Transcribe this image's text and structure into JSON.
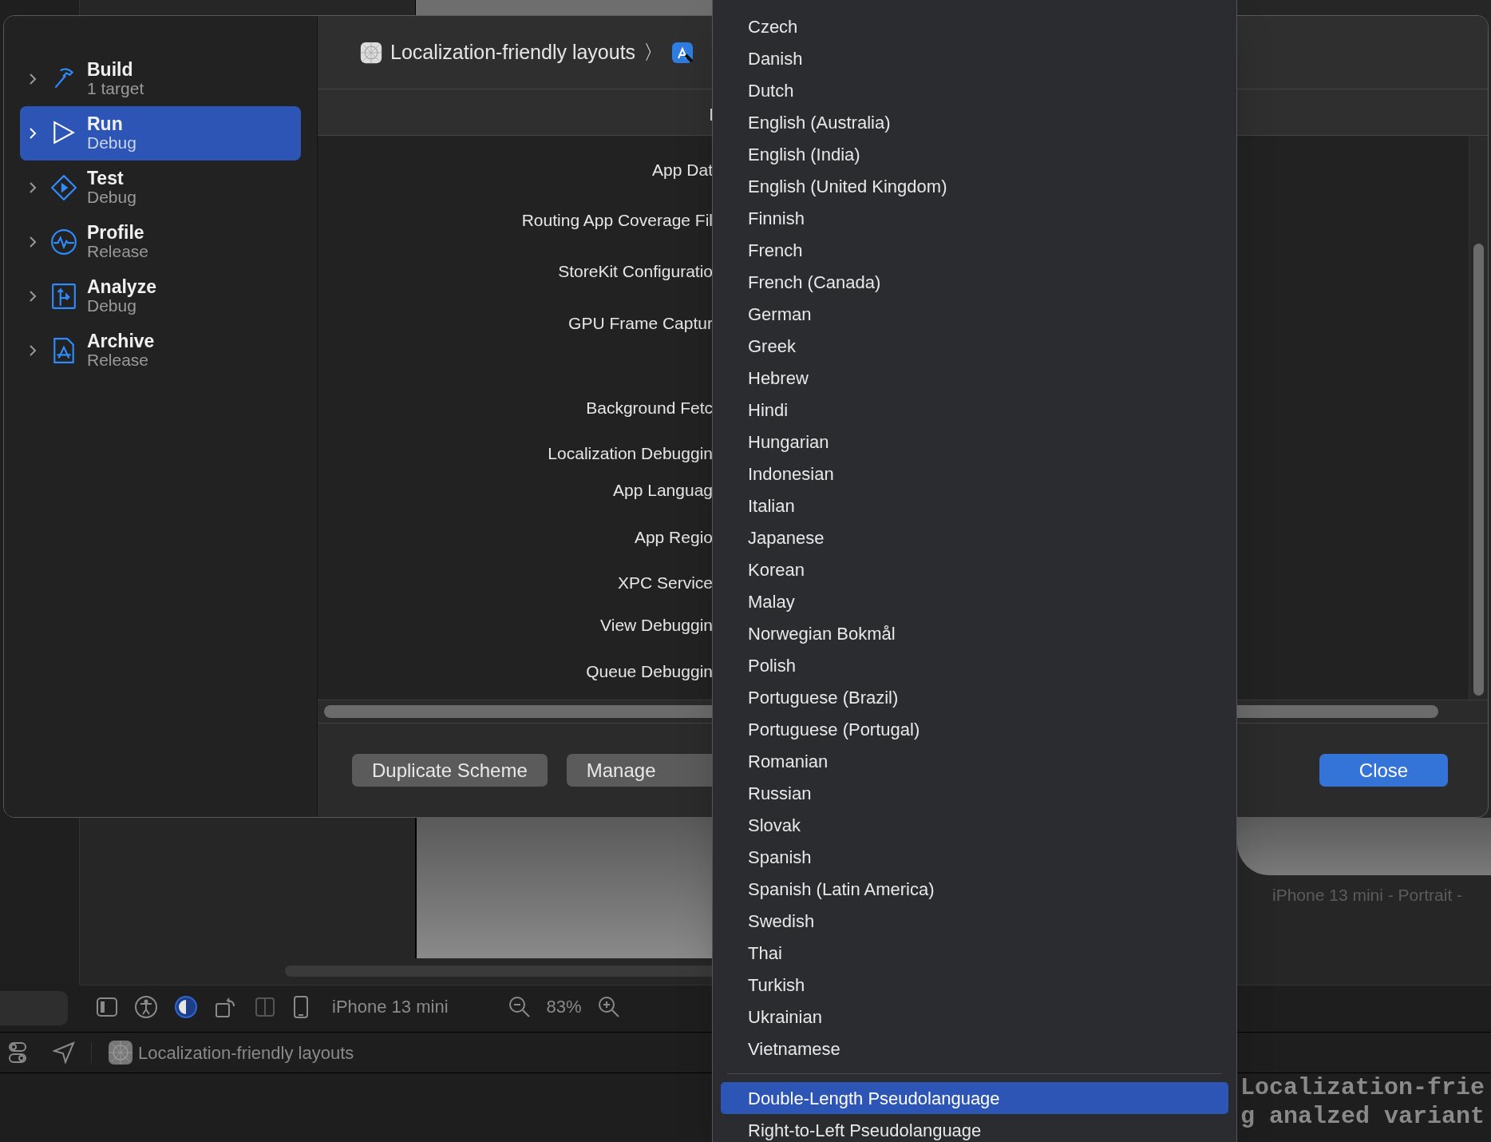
{
  "background": {
    "canvas_caption": "iPhone 13 mini - Portrait -",
    "toolbar": {
      "device": "iPhone 13 mini",
      "zoom": "83%"
    },
    "status_bar": {
      "project": "Localization-friendly layouts"
    },
    "console_lines": [
      "Localization-frie",
      "g analzed variant"
    ]
  },
  "dialog": {
    "breadcrumb": {
      "project": "Localization-friendly layouts",
      "separator": "〉"
    },
    "actions": [
      {
        "kind": "build",
        "title": "Build",
        "subtitle": "1 target",
        "selected": false
      },
      {
        "kind": "run",
        "title": "Run",
        "subtitle": "Debug",
        "selected": true
      },
      {
        "kind": "test",
        "title": "Test",
        "subtitle": "Debug",
        "selected": false
      },
      {
        "kind": "profile",
        "title": "Profile",
        "subtitle": "Release",
        "selected": false
      },
      {
        "kind": "analyze",
        "title": "Analyze",
        "subtitle": "Debug",
        "selected": false
      },
      {
        "kind": "archive",
        "title": "Archive",
        "subtitle": "Release",
        "selected": false
      }
    ],
    "tab": "I",
    "option_labels": [
      "App Dat",
      "Routing App Coverage Fil",
      "StoreKit Configuratio",
      "GPU Frame Captur",
      "Background Fetc",
      "Localization Debuggin",
      "App Languag",
      "App Regio",
      "XPC Service",
      "View Debuggin",
      "Queue Debuggin"
    ],
    "buttons": [
      {
        "label": "Duplicate Scheme",
        "kind": "secondary"
      },
      {
        "label": "Manage",
        "kind": "secondary"
      },
      {
        "label": "Close",
        "kind": "default"
      }
    ]
  },
  "language_menu": {
    "groups": [
      [
        {
          "label": "Czech",
          "selected": false
        },
        {
          "label": "Danish",
          "selected": false
        },
        {
          "label": "Dutch",
          "selected": false
        },
        {
          "label": "English (Australia)",
          "selected": false
        },
        {
          "label": "English (India)",
          "selected": false
        },
        {
          "label": "English (United Kingdom)",
          "selected": false
        },
        {
          "label": "Finnish",
          "selected": false
        },
        {
          "label": "French",
          "selected": false
        },
        {
          "label": "French (Canada)",
          "selected": false
        },
        {
          "label": "German",
          "selected": false
        },
        {
          "label": "Greek",
          "selected": false
        },
        {
          "label": "Hebrew",
          "selected": false
        },
        {
          "label": "Hindi",
          "selected": false
        },
        {
          "label": "Hungarian",
          "selected": false
        },
        {
          "label": "Indonesian",
          "selected": false
        },
        {
          "label": "Italian",
          "selected": false
        },
        {
          "label": "Japanese",
          "selected": false
        },
        {
          "label": "Korean",
          "selected": false
        },
        {
          "label": "Malay",
          "selected": false
        },
        {
          "label": "Norwegian Bokmål",
          "selected": false
        },
        {
          "label": "Polish",
          "selected": false
        },
        {
          "label": "Portuguese (Brazil)",
          "selected": false
        },
        {
          "label": "Portuguese (Portugal)",
          "selected": false
        },
        {
          "label": "Romanian",
          "selected": false
        },
        {
          "label": "Russian",
          "selected": false
        },
        {
          "label": "Slovak",
          "selected": false
        },
        {
          "label": "Spanish",
          "selected": false
        },
        {
          "label": "Spanish (Latin America)",
          "selected": false
        },
        {
          "label": "Swedish",
          "selected": false
        },
        {
          "label": "Thai",
          "selected": false
        },
        {
          "label": "Turkish",
          "selected": false
        },
        {
          "label": "Ukrainian",
          "selected": false
        },
        {
          "label": "Vietnamese",
          "selected": false
        }
      ],
      [
        {
          "label": "Double-Length Pseudolanguage",
          "selected": true
        },
        {
          "label": "Right-to-Left Pseudolanguage",
          "selected": false
        }
      ]
    ]
  }
}
